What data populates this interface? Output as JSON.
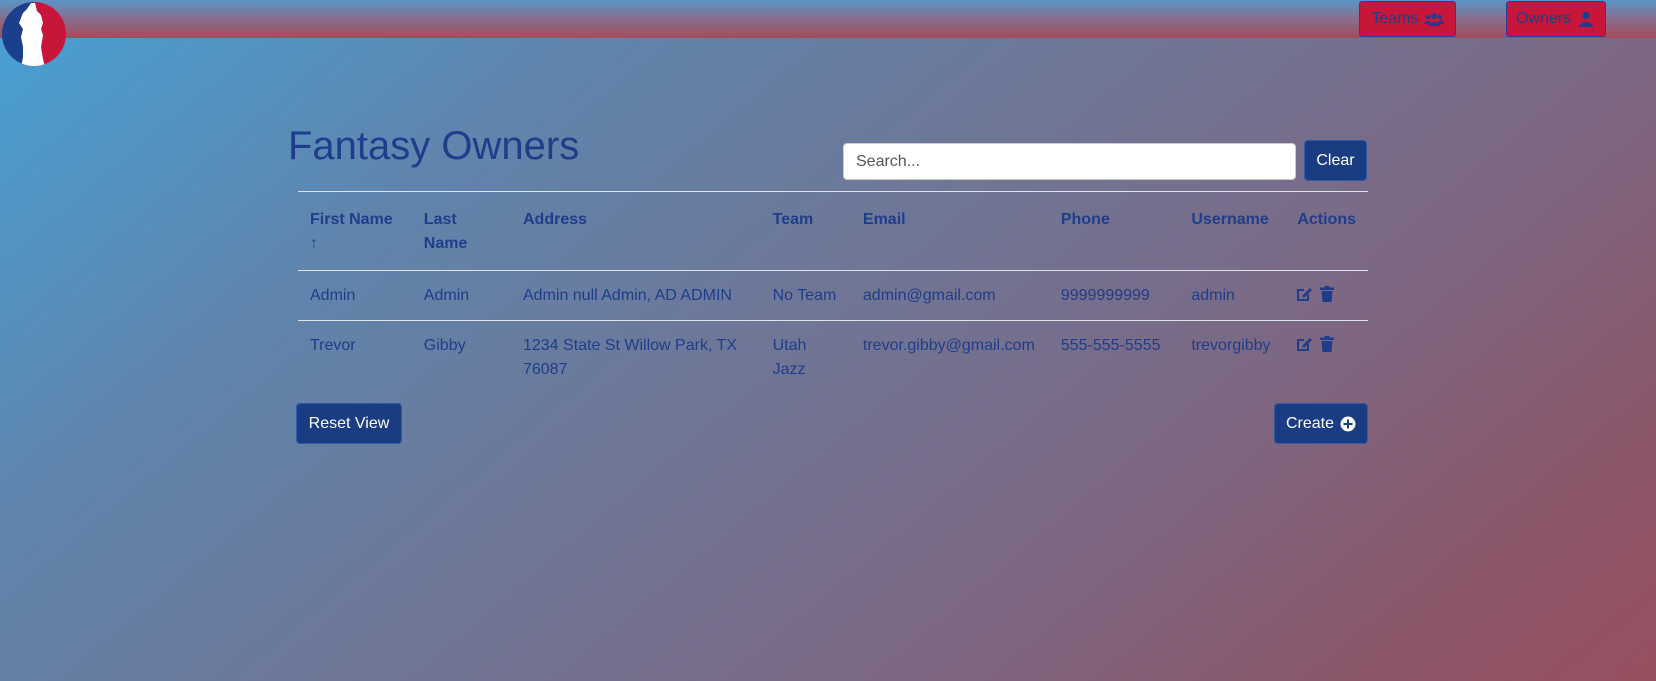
{
  "nav": {
    "teams_label": "Teams",
    "owners_label": "Owners"
  },
  "page": {
    "title": "Fantasy Owners"
  },
  "search": {
    "placeholder": "Search...",
    "clear_label": "Clear"
  },
  "table": {
    "headers": {
      "first_name": "First Name",
      "sort_indicator": "↑",
      "last_name": "Last Name",
      "address": "Address",
      "team": "Team",
      "email": "Email",
      "phone": "Phone",
      "username": "Username",
      "actions": "Actions"
    },
    "rows": [
      {
        "first_name": "Admin",
        "last_name": "Admin",
        "address": "Admin null Admin, AD ADMIN",
        "team": "No Team",
        "email": "admin@gmail.com",
        "phone": "9999999999",
        "username": "admin"
      },
      {
        "first_name": "Trevor",
        "last_name": "Gibby",
        "address": "1234 State St Willow Park, TX 76087",
        "team": "Utah Jazz",
        "email": "trevor.gibby@gmail.com",
        "phone": "555-555-5555",
        "username": "trevorgibby"
      }
    ]
  },
  "footer": {
    "reset_label": "Reset View",
    "create_label": "Create"
  },
  "colors": {
    "accent_red": "#c8163b",
    "primary_blue": "#1a3c82",
    "text_blue": "#1f3d8a"
  },
  "icons": {
    "teams": "users-icon",
    "owners": "user-icon",
    "edit": "edit-icon",
    "delete": "trash-icon",
    "create": "plus-circle-icon",
    "sort": "arrow-up-icon",
    "logo": "basketball-player-logo"
  }
}
